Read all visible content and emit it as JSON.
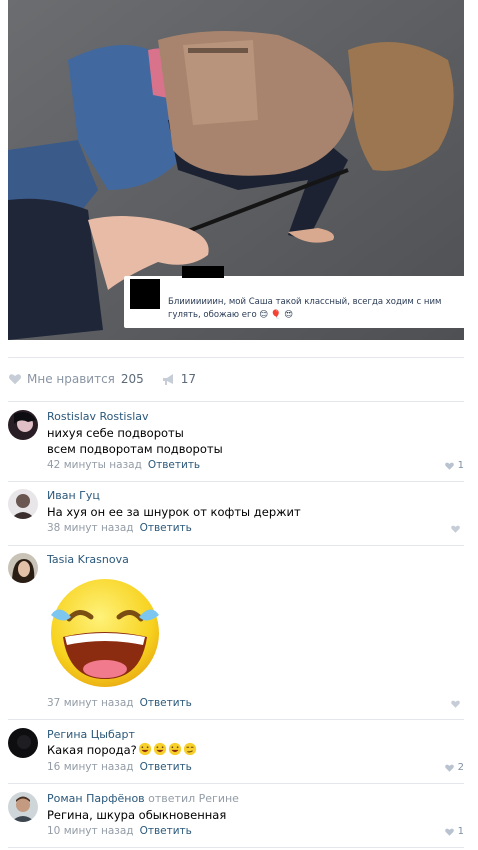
{
  "post": {
    "caption_text": "Блииииииин, мой Саша такой классный, всегда ходим с ним гулять, обожаю его 😊 🎈 😍",
    "likes_label": "Мне нравится",
    "likes_count": "205",
    "reposts_count": "17"
  },
  "comments": [
    {
      "author": "Rostislav Rostislav",
      "lines": [
        "нихуя себе подвороты",
        "всем подворотам подвороты"
      ],
      "time": "42 минуты назад",
      "reply_label": "Ответить",
      "likes": "1"
    },
    {
      "author": "Иван Гуц",
      "lines": [
        "На хуя он ее за шнурок от кофты держит"
      ],
      "time": "38 минут назад",
      "reply_label": "Ответить",
      "likes": ""
    },
    {
      "author": "Tasia Krasnova",
      "lines": [],
      "sticker": "laughing-crying-sticker",
      "time": "37 минут назад",
      "reply_label": "Ответить",
      "likes": ""
    },
    {
      "author": "Регина Цыбарт",
      "lines": [
        "Какая порода?"
      ],
      "time": "16 минут назад",
      "reply_label": "Ответить",
      "likes": "2"
    },
    {
      "author": "Роман Парфёнов",
      "reply_to": "ответил Регине",
      "lines": [
        "Регина, шкура обыкновенная"
      ],
      "time": "10 минут назад",
      "reply_label": "Ответить",
      "likes": "1"
    }
  ],
  "colors": {
    "link": "#2b587a",
    "meta": "#939ca6",
    "separator": "#e3e6ea"
  },
  "icons": [
    "heart-icon",
    "megaphone-icon",
    "laughing-crying-emoji"
  ]
}
